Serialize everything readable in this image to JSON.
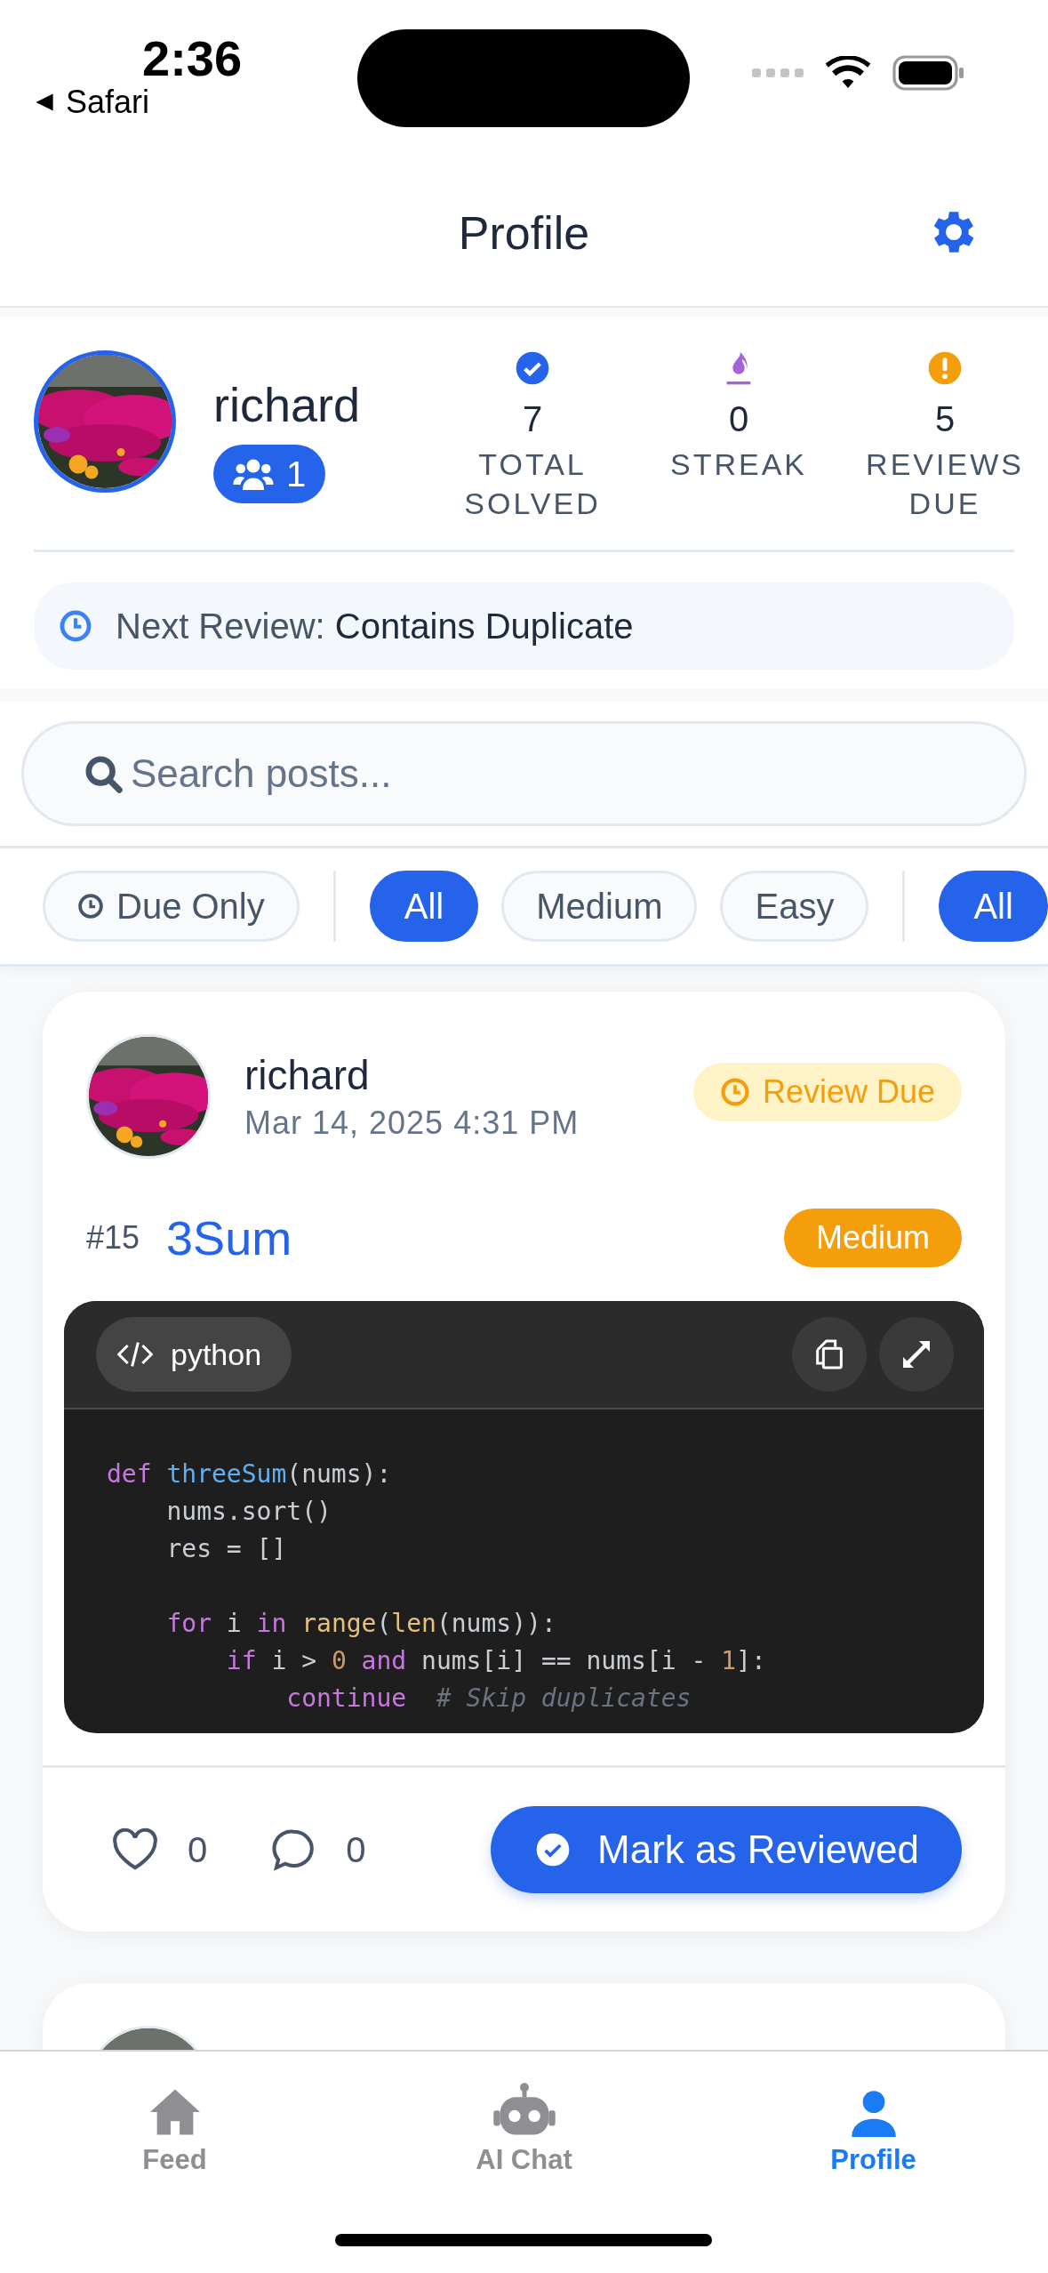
{
  "status_bar": {
    "time": "2:36",
    "back_label": "Safari"
  },
  "header": {
    "title": "Profile"
  },
  "profile": {
    "username": "richard",
    "followers": "1",
    "stats": [
      {
        "kind": "solved",
        "value": "7",
        "label": "TOTAL SOLVED"
      },
      {
        "kind": "streak",
        "value": "0",
        "label": "STREAK"
      },
      {
        "kind": "due",
        "value": "5",
        "label": "REVIEWS DUE"
      }
    ],
    "next_review": {
      "label": "Next Review:",
      "problem": "Contains Duplicate"
    }
  },
  "search": {
    "placeholder": "Search posts..."
  },
  "filters": {
    "due_only": {
      "label": "Due Only",
      "selected": false
    },
    "difficulty": [
      {
        "label": "All",
        "selected": true
      },
      {
        "label": "Medium",
        "selected": false
      },
      {
        "label": "Easy",
        "selected": false
      }
    ],
    "category": [
      {
        "label": "All",
        "selected": true
      }
    ]
  },
  "posts": [
    {
      "author": "richard",
      "date": "Mar 14, 2025 4:31 PM",
      "status": "Review Due",
      "number": "#15",
      "title": "3Sum",
      "difficulty": "Medium",
      "language": "python",
      "code": [
        {
          "kind": "code",
          "tokens": [
            {
              "kind": "keyword",
              "text": "def "
            },
            {
              "kind": "function",
              "text": "threeSum"
            },
            {
              "kind": "plain",
              "text": "(nums):"
            }
          ]
        },
        {
          "kind": "code",
          "tokens": [
            {
              "kind": "plain",
              "text": "    nums.sort()"
            }
          ]
        },
        {
          "kind": "code",
          "tokens": [
            {
              "kind": "plain",
              "text": "    res = []"
            }
          ]
        },
        {
          "kind": "blank"
        },
        {
          "kind": "code",
          "tokens": [
            {
              "kind": "keyword",
              "text": "    for"
            },
            {
              "kind": "plain",
              "text": " i "
            },
            {
              "kind": "keyword",
              "text": "in"
            },
            {
              "kind": "builtin",
              "text": " range"
            },
            {
              "kind": "plain",
              "text": "("
            },
            {
              "kind": "builtin",
              "text": "len"
            },
            {
              "kind": "plain",
              "text": "(nums)):"
            }
          ]
        },
        {
          "kind": "code",
          "tokens": [
            {
              "kind": "keyword",
              "text": "        if"
            },
            {
              "kind": "plain",
              "text": " i > "
            },
            {
              "kind": "number",
              "text": "0"
            },
            {
              "kind": "keyword",
              "text": " and"
            },
            {
              "kind": "plain",
              "text": " nums[i] == nums[i - "
            },
            {
              "kind": "number",
              "text": "1"
            },
            {
              "kind": "plain",
              "text": "]:"
            }
          ]
        },
        {
          "kind": "code",
          "tokens": [
            {
              "kind": "keyword",
              "text": "            continue"
            },
            {
              "kind": "comment",
              "text": "  # Skip duplicates"
            }
          ]
        }
      ],
      "likes": "0",
      "comments": "0",
      "action": "Mark as Reviewed"
    },
    {
      "kind": "picture"
    }
  ],
  "tabs": [
    {
      "kind": "home",
      "label": "Feed",
      "selected": false
    },
    {
      "kind": "robot",
      "label": "AI Chat",
      "selected": false
    },
    {
      "kind": "person",
      "label": "Profile",
      "selected": true
    }
  ]
}
